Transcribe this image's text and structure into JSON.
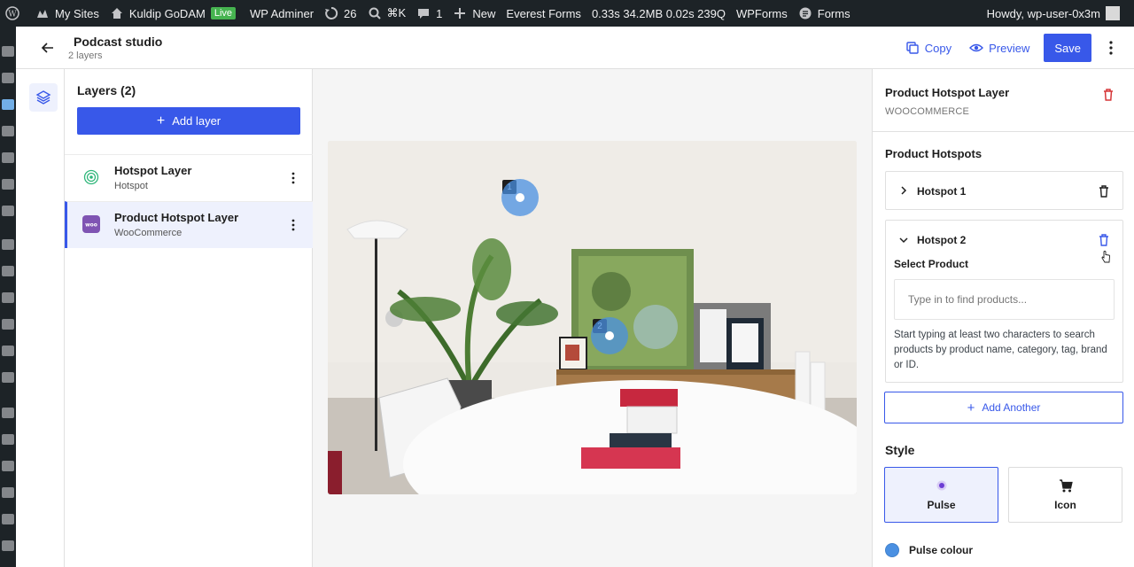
{
  "admin_bar": {
    "my_sites": "My Sites",
    "site_name": "Kuldip GoDAM",
    "live_badge": "Live",
    "wp_adminer": "WP Adminer",
    "updates_count": "26",
    "shortcut": "⌘K",
    "comments_count": "1",
    "new_label": "New",
    "everest_forms": "Everest Forms",
    "perf_stats": "0.33s  34.2MB  0.02s  239Q",
    "wpforms": "WPForms",
    "forms": "Forms",
    "howdy": "Howdy, wp-user-0x3m"
  },
  "header": {
    "title": "Podcast studio",
    "subtitle": "2 layers",
    "copy_label": "Copy",
    "preview_label": "Preview",
    "save_label": "Save"
  },
  "layers_panel": {
    "title": "Layers (2)",
    "add_layer_label": "Add layer",
    "layers": [
      {
        "name": "Hotspot Layer",
        "type": "Hotspot"
      },
      {
        "name": "Product Hotspot Layer",
        "type": "WooCommerce"
      }
    ]
  },
  "canvas": {
    "hotspots": [
      {
        "number": "1"
      },
      {
        "number": "2"
      }
    ]
  },
  "settings": {
    "layer_title": "Product Hotspot Layer",
    "layer_subtitle": "WOOCOMMERCE",
    "hotspots_section": "Product Hotspots",
    "hotspot_1_label": "Hotspot 1",
    "hotspot_2_label": "Hotspot 2",
    "select_product_label": "Select Product",
    "product_search_placeholder": "Type in to find products...",
    "help_text": "Start typing at least two characters to search products by product name, category, tag, brand or ID.",
    "add_another_label": "Add Another",
    "style_section": "Style",
    "style_options": [
      {
        "label": "Pulse",
        "selected": true
      },
      {
        "label": "Icon",
        "selected": false
      }
    ],
    "pulse_colour_label": "Pulse colour",
    "pulse_colour_value": "#4a90e2"
  },
  "colors": {
    "accent": "#3858e9",
    "admin_bar_bg": "#1d2327",
    "delete_red": "#d63638",
    "live_green": "#46b450",
    "woo_purple": "#7f54b3"
  }
}
